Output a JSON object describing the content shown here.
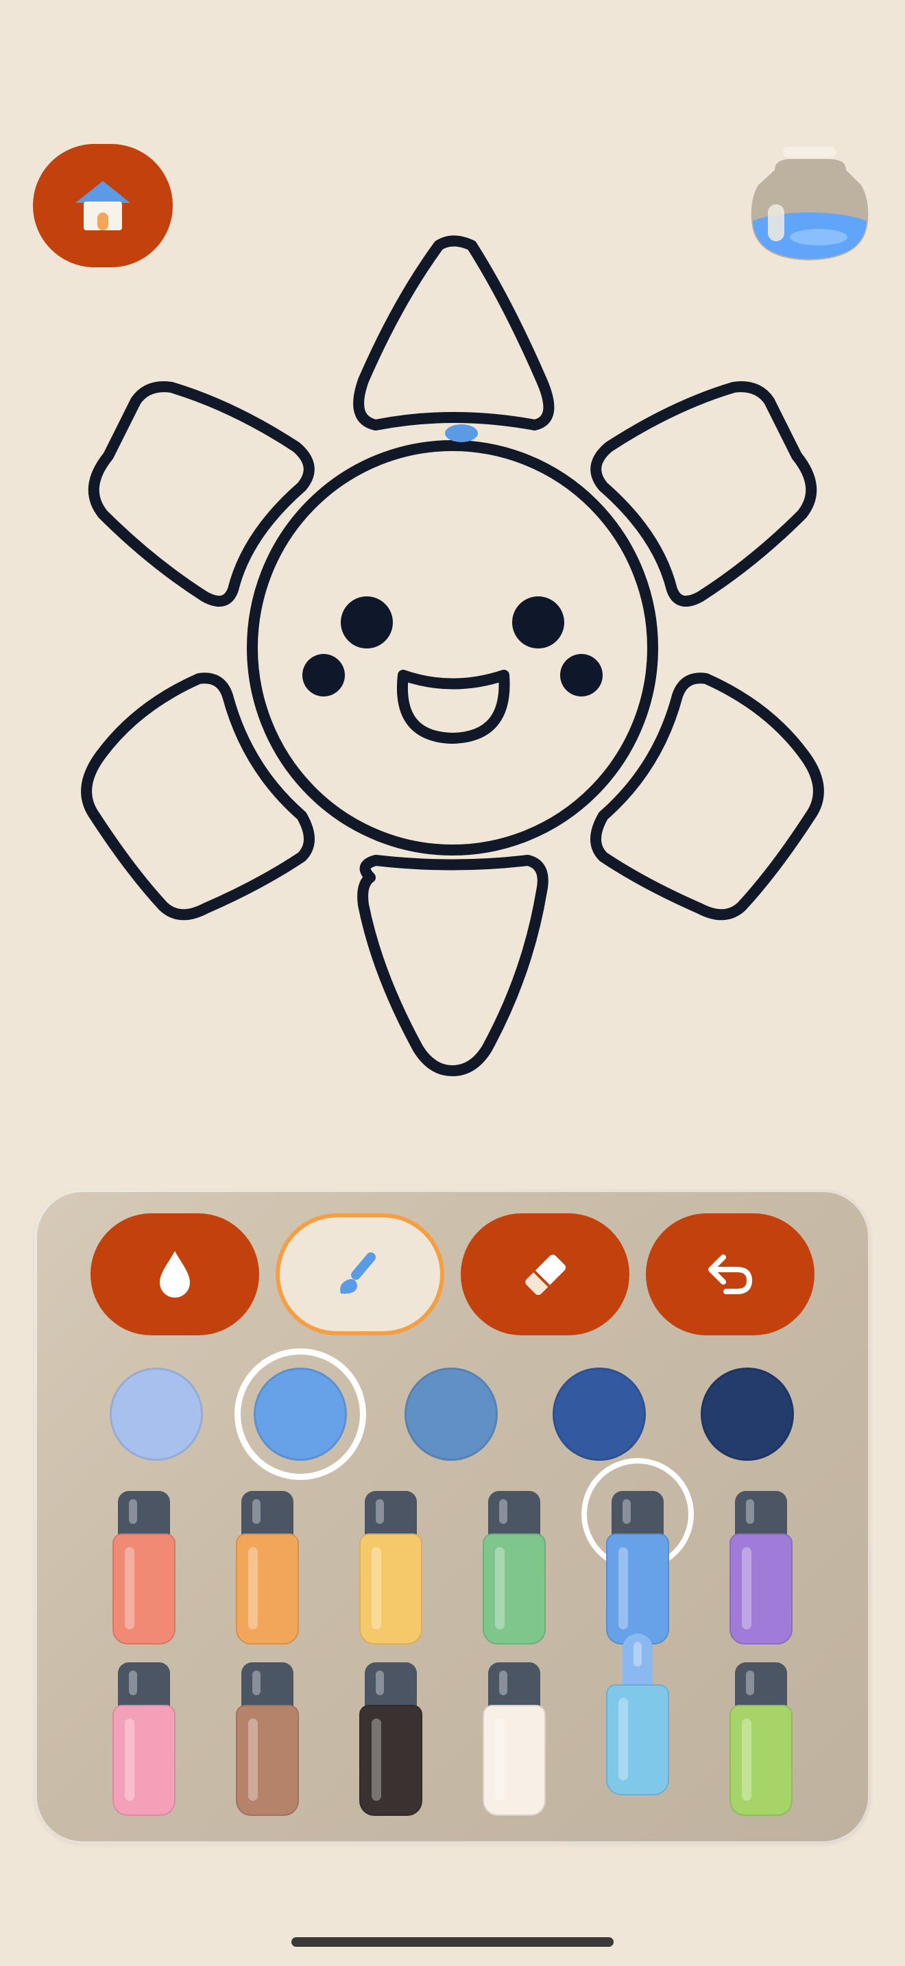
{
  "app": {
    "screen": "coloring-canvas"
  },
  "top_bar": {
    "home_icon": "house-icon",
    "jar_icon": "paint-jar-icon",
    "jar_fill_color": "#60a5fa",
    "jar_fill_level": 0.3
  },
  "drawing": {
    "subject": "smiling-sun-flower",
    "outline_color": "#111827",
    "paint_dot_color": "#5b9be6"
  },
  "tools": [
    {
      "name": "fill",
      "icon": "drop-icon",
      "selected": false
    },
    {
      "name": "brush",
      "icon": "brush-icon",
      "selected": true
    },
    {
      "name": "eraser",
      "icon": "eraser-icon",
      "selected": false
    },
    {
      "name": "undo",
      "icon": "undo-icon",
      "selected": false
    }
  ],
  "shades": {
    "colors": [
      "#a8c0ee",
      "#67a1e8",
      "#6190c6",
      "#335aa1",
      "#233c6c"
    ],
    "selected_index": 1
  },
  "bottles": {
    "row1": [
      "#f08a74",
      "#f2a65a",
      "#f5c96a",
      "#7ec68c",
      "#67a1e8",
      "#a07cd8"
    ],
    "row2": [
      "#f4a0b8",
      "#b5826a",
      "#3a3230",
      "#f8f0e6",
      "#7fc8ea",
      "#a6d468"
    ],
    "picked": {
      "row": 1,
      "index": 4
    }
  },
  "accent_colors": {
    "tool_button": "#c2410c",
    "selected_border": "#f59e42"
  }
}
